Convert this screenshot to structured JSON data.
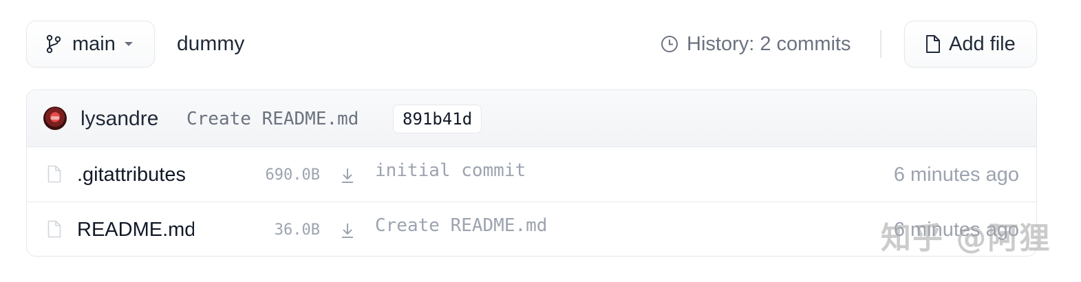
{
  "header": {
    "branch_label": "main",
    "repo_name": "dummy",
    "history_label": "History: 2 commits",
    "add_file_label": "Add file"
  },
  "last_commit": {
    "author": "lysandre",
    "message": "Create README.md",
    "hash": "891b41d"
  },
  "files": [
    {
      "name": ".gitattributes",
      "size": "690.0B",
      "commit_message": "initial commit",
      "time": "6 minutes ago"
    },
    {
      "name": "README.md",
      "size": "36.0B",
      "commit_message": "Create README.md",
      "time": "6 minutes ago"
    }
  ],
  "watermark": {
    "text": "知乎 @阿狸"
  },
  "icons": {
    "branch": "git-branch-icon",
    "caret": "caret-down-icon",
    "history": "clock-icon",
    "add_file": "file-icon",
    "file": "file-icon",
    "download": "download-icon",
    "avatar": "avatar"
  }
}
